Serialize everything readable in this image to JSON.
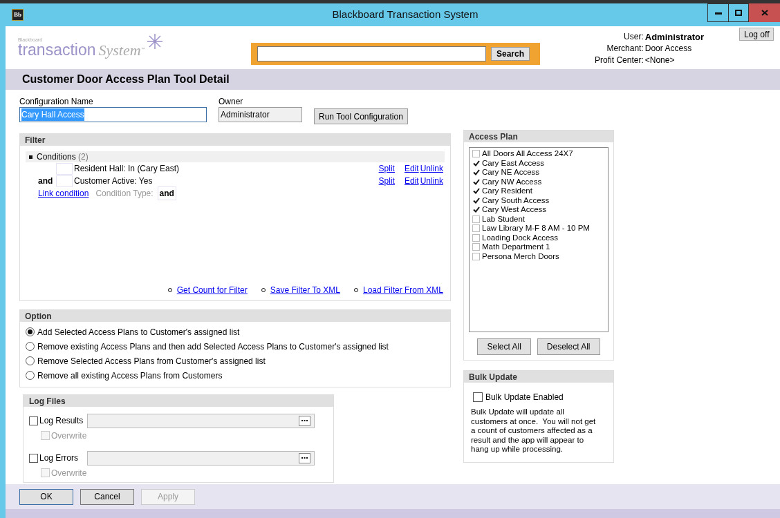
{
  "window": {
    "title": "Blackboard Transaction System",
    "app_icon": "Bb"
  },
  "logo": {
    "brand": "Blackboard",
    "word": "transaction",
    "word2": "System",
    "mark": "™"
  },
  "search": {
    "button": "Search"
  },
  "user_info": [
    {
      "label": "User:",
      "value": "Administrator",
      "bold": true
    },
    {
      "label": "Merchant:",
      "value": "Door Access",
      "bold": false
    },
    {
      "label": "Profit Center:",
      "value": "<None>",
      "bold": false
    }
  ],
  "logoff": "Log off",
  "page_title": "Customer Door Access Plan Tool Detail",
  "config": {
    "name_label": "Configuration Name",
    "name_value": "Cary Hall Access",
    "highlighted": true,
    "owner_label": "Owner",
    "owner_value": "Administrator",
    "run_button": "Run Tool Configuration"
  },
  "filter": {
    "title": "Filter",
    "conditions_label": "Conditions",
    "conditions_count": "(2)",
    "conditions": [
      {
        "checked": false,
        "text": "Resident Hall: In (Cary East)",
        "actions": [
          "Split",
          "Edit",
          "Unlink"
        ]
      },
      {
        "connector": "and",
        "checked": false,
        "text": "Customer Active: Yes",
        "actions": [
          "Split",
          "Edit",
          "Unlink"
        ]
      }
    ],
    "link_condition": "Link condition",
    "condition_type_label": "Condition Type:",
    "condition_type": "and",
    "links": [
      "Get Count for Filter",
      "Save Filter To XML",
      "Load Filter From XML"
    ]
  },
  "option": {
    "title": "Option",
    "items": [
      {
        "label": "Add Selected Access Plans to Customer's assigned list",
        "selected": true
      },
      {
        "label": "Remove existing Access Plans and then add Selected Access Plans to Customer's assigned list",
        "selected": false
      },
      {
        "label": "Remove Selected Access Plans from Customer's assigned list",
        "selected": false
      },
      {
        "label": "Remove all existing Access Plans from Customers",
        "selected": false
      }
    ]
  },
  "log_files": {
    "title": "Log Files",
    "rows": [
      {
        "label": "Log Results",
        "checked": false,
        "overwrite": {
          "label": "Overwrite",
          "checked": false,
          "disabled": true
        }
      },
      {
        "label": "Log Errors",
        "checked": false,
        "overwrite": {
          "label": "Overwrite",
          "checked": false,
          "disabled": true
        }
      }
    ]
  },
  "access_plan": {
    "title": "Access Plan",
    "items": [
      {
        "label": "All Doors All Access 24X7",
        "checked": false
      },
      {
        "label": "Cary East Access",
        "checked": true
      },
      {
        "label": "Cary NE Access",
        "checked": true
      },
      {
        "label": "Cary NW Access",
        "checked": true
      },
      {
        "label": "Cary Resident",
        "checked": true
      },
      {
        "label": "Cary South Access",
        "checked": true
      },
      {
        "label": "Cary West Access",
        "checked": true
      },
      {
        "label": "Lab Student",
        "checked": false
      },
      {
        "label": "Law Library M-F 8 AM - 10 PM",
        "checked": false
      },
      {
        "label": "Loading Dock Access",
        "checked": false
      },
      {
        "label": "Math Department 1",
        "checked": false
      },
      {
        "label": "Persona Merch Doors",
        "checked": false
      }
    ],
    "buttons": [
      "Select All",
      "Deselect All"
    ]
  },
  "bulk_update": {
    "title": "Bulk Update",
    "checkbox": {
      "label": "Bulk Update Enabled",
      "checked": false
    },
    "note": "Bulk Update will update all customers at once.  You will not get a count of customers affected as a result and the app will appear to hang up while processing."
  },
  "footer_buttons": [
    {
      "label": "OK",
      "disabled": false
    },
    {
      "label": "Cancel",
      "disabled": false
    },
    {
      "label": "Apply",
      "disabled": true
    }
  ]
}
